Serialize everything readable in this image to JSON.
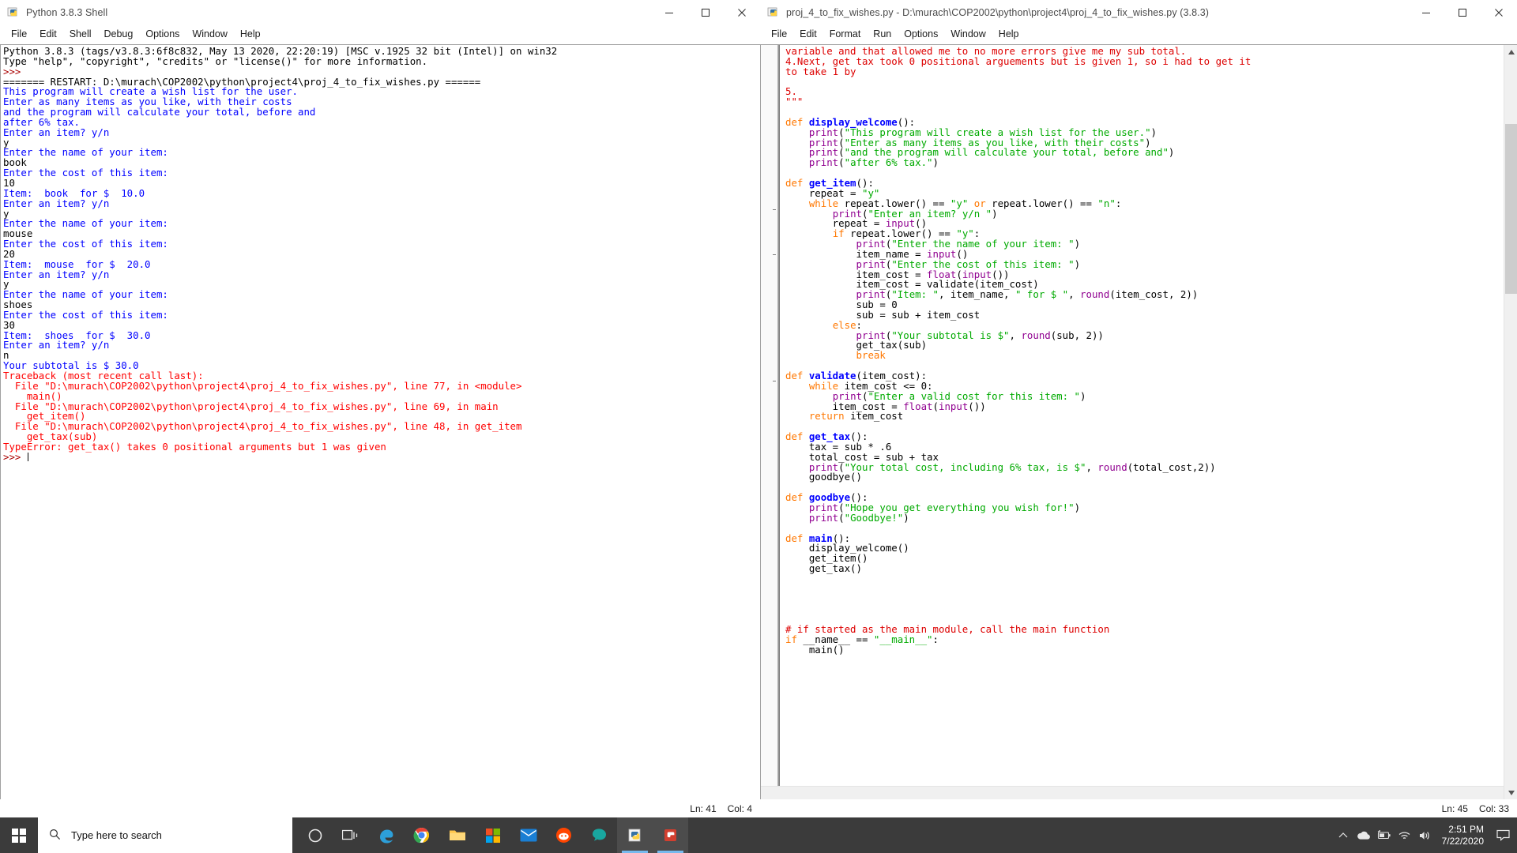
{
  "shell_window": {
    "title": "Python 3.8.3 Shell",
    "icon": "python-idle-icon",
    "menus": [
      "File",
      "Edit",
      "Shell",
      "Debug",
      "Options",
      "Window",
      "Help"
    ],
    "window_controls": {
      "minimize": "minimize-icon",
      "maximize": "maximize-icon",
      "close": "close-icon"
    },
    "status": {
      "line": "Ln: 41",
      "col": "Col: 4"
    },
    "output_lines": [
      {
        "type": "banner",
        "text": "Python 3.8.3 (tags/v3.8.3:6f8c832, May 13 2020, 22:20:19) [MSC v.1925 32 bit (Intel)] on win32"
      },
      {
        "type": "banner",
        "text": "Type \"help\", \"copyright\", \"credits\" or \"license()\" for more information."
      },
      {
        "type": "prompt",
        "text": ">>>"
      },
      {
        "type": "restart",
        "text": "======= RESTART: D:\\murach\\COP2002\\python\\project4\\proj_4_to_fix_wishes.py ======"
      },
      {
        "type": "output",
        "text": "This program will create a wish list for the user."
      },
      {
        "type": "output",
        "text": "Enter as many items as you like, with their costs"
      },
      {
        "type": "output",
        "text": "and the program will calculate your total, before and"
      },
      {
        "type": "output",
        "text": "after 6% tax."
      },
      {
        "type": "output",
        "text": "Enter an item? y/n"
      },
      {
        "type": "input",
        "text": "y"
      },
      {
        "type": "output",
        "text": "Enter the name of your item:"
      },
      {
        "type": "input",
        "text": "book"
      },
      {
        "type": "output",
        "text": "Enter the cost of this item:"
      },
      {
        "type": "input",
        "text": "10"
      },
      {
        "type": "output",
        "text": "Item:  book  for $  10.0"
      },
      {
        "type": "output",
        "text": "Enter an item? y/n"
      },
      {
        "type": "input",
        "text": "y"
      },
      {
        "type": "output",
        "text": "Enter the name of your item:"
      },
      {
        "type": "input",
        "text": "mouse"
      },
      {
        "type": "output",
        "text": "Enter the cost of this item:"
      },
      {
        "type": "input",
        "text": "20"
      },
      {
        "type": "output",
        "text": "Item:  mouse  for $  20.0"
      },
      {
        "type": "output",
        "text": "Enter an item? y/n"
      },
      {
        "type": "input",
        "text": "y"
      },
      {
        "type": "output",
        "text": "Enter the name of your item:"
      },
      {
        "type": "input",
        "text": "shoes"
      },
      {
        "type": "output",
        "text": "Enter the cost of this item:"
      },
      {
        "type": "input",
        "text": "30"
      },
      {
        "type": "output",
        "text": "Item:  shoes  for $  30.0"
      },
      {
        "type": "output",
        "text": "Enter an item? y/n"
      },
      {
        "type": "input",
        "text": "n"
      },
      {
        "type": "output",
        "text": "Your subtotal is $ 30.0"
      },
      {
        "type": "error",
        "text": "Traceback (most recent call last):"
      },
      {
        "type": "error",
        "text": "  File \"D:\\murach\\COP2002\\python\\project4\\proj_4_to_fix_wishes.py\", line 77, in <module>"
      },
      {
        "type": "error",
        "text": "    main()"
      },
      {
        "type": "error",
        "text": "  File \"D:\\murach\\COP2002\\python\\project4\\proj_4_to_fix_wishes.py\", line 69, in main"
      },
      {
        "type": "error",
        "text": "    get_item()"
      },
      {
        "type": "error",
        "text": "  File \"D:\\murach\\COP2002\\python\\project4\\proj_4_to_fix_wishes.py\", line 48, in get_item"
      },
      {
        "type": "error",
        "text": "    get_tax(sub)"
      },
      {
        "type": "error",
        "text": "TypeError: get_tax() takes 0 positional arguments but 1 was given"
      },
      {
        "type": "prompt_cursor",
        "text": ">>> "
      }
    ]
  },
  "editor_window": {
    "title": "proj_4_to_fix_wishes.py - D:\\murach\\COP2002\\python\\project4\\proj_4_to_fix_wishes.py (3.8.3)",
    "icon": "python-idle-icon",
    "menus": [
      "File",
      "Edit",
      "Format",
      "Run",
      "Options",
      "Window",
      "Help"
    ],
    "window_controls": {
      "minimize": "minimize-icon",
      "maximize": "maximize-icon",
      "close": "close-icon"
    },
    "status": {
      "line": "Ln: 45",
      "col": "Col: 33"
    },
    "code_lines": [
      [
        {
          "c": "com",
          "t": "variable and that allowed me to no more errors give me my sub total."
        }
      ],
      [
        {
          "c": "com",
          "t": "4.Next, get tax took 0 positional arguements but is given 1, so i had to get it"
        }
      ],
      [
        {
          "c": "com",
          "t": "to take 1 by"
        }
      ],
      [],
      [
        {
          "c": "com",
          "t": "5."
        }
      ],
      [
        {
          "c": "com",
          "t": "\"\"\""
        }
      ],
      [],
      [
        {
          "c": "kw",
          "t": "def "
        },
        {
          "c": "def",
          "t": "display_welcome"
        },
        {
          "c": "plain",
          "t": "():"
        }
      ],
      [
        {
          "c": "plain",
          "t": "    "
        },
        {
          "c": "bi",
          "t": "print"
        },
        {
          "c": "plain",
          "t": "("
        },
        {
          "c": "str",
          "t": "\"This program will create a wish list for the user.\""
        },
        {
          "c": "plain",
          "t": ")"
        }
      ],
      [
        {
          "c": "plain",
          "t": "    "
        },
        {
          "c": "bi",
          "t": "print"
        },
        {
          "c": "plain",
          "t": "("
        },
        {
          "c": "str",
          "t": "\"Enter as many items as you like, with their costs\""
        },
        {
          "c": "plain",
          "t": ")"
        }
      ],
      [
        {
          "c": "plain",
          "t": "    "
        },
        {
          "c": "bi",
          "t": "print"
        },
        {
          "c": "plain",
          "t": "("
        },
        {
          "c": "str",
          "t": "\"and the program will calculate your total, before and\""
        },
        {
          "c": "plain",
          "t": ")"
        }
      ],
      [
        {
          "c": "plain",
          "t": "    "
        },
        {
          "c": "bi",
          "t": "print"
        },
        {
          "c": "plain",
          "t": "("
        },
        {
          "c": "str",
          "t": "\"after 6% tax.\""
        },
        {
          "c": "plain",
          "t": ")"
        }
      ],
      [],
      [
        {
          "c": "kw",
          "t": "def "
        },
        {
          "c": "def",
          "t": "get_item"
        },
        {
          "c": "plain",
          "t": "():"
        }
      ],
      [
        {
          "c": "plain",
          "t": "    repeat = "
        },
        {
          "c": "str",
          "t": "\"y\""
        }
      ],
      [
        {
          "c": "plain",
          "t": "    "
        },
        {
          "c": "kw",
          "t": "while"
        },
        {
          "c": "plain",
          "t": " repeat.lower() == "
        },
        {
          "c": "str",
          "t": "\"y\""
        },
        {
          "c": "kw",
          "t": " or "
        },
        {
          "c": "plain",
          "t": "repeat.lower() == "
        },
        {
          "c": "str",
          "t": "\"n\""
        },
        {
          "c": "plain",
          "t": ":"
        }
      ],
      [
        {
          "c": "plain",
          "t": "        "
        },
        {
          "c": "bi",
          "t": "print"
        },
        {
          "c": "plain",
          "t": "("
        },
        {
          "c": "str",
          "t": "\"Enter an item? y/n \""
        },
        {
          "c": "plain",
          "t": ")"
        }
      ],
      [
        {
          "c": "plain",
          "t": "        repeat = "
        },
        {
          "c": "bi",
          "t": "input"
        },
        {
          "c": "plain",
          "t": "()"
        }
      ],
      [
        {
          "c": "plain",
          "t": "        "
        },
        {
          "c": "kw",
          "t": "if"
        },
        {
          "c": "plain",
          "t": " repeat.lower() == "
        },
        {
          "c": "str",
          "t": "\"y\""
        },
        {
          "c": "plain",
          "t": ":"
        }
      ],
      [
        {
          "c": "plain",
          "t": "            "
        },
        {
          "c": "bi",
          "t": "print"
        },
        {
          "c": "plain",
          "t": "("
        },
        {
          "c": "str",
          "t": "\"Enter the name of your item: \""
        },
        {
          "c": "plain",
          "t": ")"
        }
      ],
      [
        {
          "c": "plain",
          "t": "            item_name = "
        },
        {
          "c": "bi",
          "t": "input"
        },
        {
          "c": "plain",
          "t": "()"
        }
      ],
      [
        {
          "c": "plain",
          "t": "            "
        },
        {
          "c": "bi",
          "t": "print"
        },
        {
          "c": "plain",
          "t": "("
        },
        {
          "c": "str",
          "t": "\"Enter the cost of this item: \""
        },
        {
          "c": "plain",
          "t": ")"
        }
      ],
      [
        {
          "c": "plain",
          "t": "            item_cost = "
        },
        {
          "c": "bi",
          "t": "float"
        },
        {
          "c": "plain",
          "t": "("
        },
        {
          "c": "bi",
          "t": "input"
        },
        {
          "c": "plain",
          "t": "())"
        }
      ],
      [
        {
          "c": "plain",
          "t": "            item_cost = validate(item_cost)"
        }
      ],
      [
        {
          "c": "plain",
          "t": "            "
        },
        {
          "c": "bi",
          "t": "print"
        },
        {
          "c": "plain",
          "t": "("
        },
        {
          "c": "str",
          "t": "\"Item: \""
        },
        {
          "c": "plain",
          "t": ", item_name, "
        },
        {
          "c": "str",
          "t": "\" for $ \""
        },
        {
          "c": "plain",
          "t": ", "
        },
        {
          "c": "bi",
          "t": "round"
        },
        {
          "c": "plain",
          "t": "(item_cost, 2))"
        }
      ],
      [
        {
          "c": "plain",
          "t": "            sub = 0"
        }
      ],
      [
        {
          "c": "plain",
          "t": "            sub = sub + item_cost"
        }
      ],
      [
        {
          "c": "plain",
          "t": "        "
        },
        {
          "c": "kw",
          "t": "else"
        },
        {
          "c": "plain",
          "t": ":"
        }
      ],
      [
        {
          "c": "plain",
          "t": "            "
        },
        {
          "c": "bi",
          "t": "print"
        },
        {
          "c": "plain",
          "t": "("
        },
        {
          "c": "str",
          "t": "\"Your subtotal is $\""
        },
        {
          "c": "plain",
          "t": ", "
        },
        {
          "c": "bi",
          "t": "round"
        },
        {
          "c": "plain",
          "t": "(sub, 2))"
        }
      ],
      [
        {
          "c": "plain",
          "t": "            get_tax(sub)"
        }
      ],
      [
        {
          "c": "plain",
          "t": "            "
        },
        {
          "c": "kw",
          "t": "break"
        }
      ],
      [],
      [
        {
          "c": "kw",
          "t": "def "
        },
        {
          "c": "def",
          "t": "validate"
        },
        {
          "c": "plain",
          "t": "(item_cost):"
        }
      ],
      [
        {
          "c": "plain",
          "t": "    "
        },
        {
          "c": "kw",
          "t": "while"
        },
        {
          "c": "plain",
          "t": " item_cost <= 0:"
        }
      ],
      [
        {
          "c": "plain",
          "t": "        "
        },
        {
          "c": "bi",
          "t": "print"
        },
        {
          "c": "plain",
          "t": "("
        },
        {
          "c": "str",
          "t": "\"Enter a valid cost for this item: \""
        },
        {
          "c": "plain",
          "t": ")"
        }
      ],
      [
        {
          "c": "plain",
          "t": "        item_cost = "
        },
        {
          "c": "bi",
          "t": "float"
        },
        {
          "c": "plain",
          "t": "("
        },
        {
          "c": "bi",
          "t": "input"
        },
        {
          "c": "plain",
          "t": "())"
        }
      ],
      [
        {
          "c": "plain",
          "t": "    "
        },
        {
          "c": "kw",
          "t": "return"
        },
        {
          "c": "plain",
          "t": " item_cost"
        }
      ],
      [],
      [
        {
          "c": "kw",
          "t": "def "
        },
        {
          "c": "def",
          "t": "get_tax"
        },
        {
          "c": "plain",
          "t": "():"
        }
      ],
      [
        {
          "c": "plain",
          "t": "    tax = sub * .6"
        }
      ],
      [
        {
          "c": "plain",
          "t": "    total_cost = sub + tax"
        }
      ],
      [
        {
          "c": "plain",
          "t": "    "
        },
        {
          "c": "bi",
          "t": "print"
        },
        {
          "c": "plain",
          "t": "("
        },
        {
          "c": "str",
          "t": "\"Your total cost, including 6% tax, is $\""
        },
        {
          "c": "plain",
          "t": ", "
        },
        {
          "c": "bi",
          "t": "round"
        },
        {
          "c": "plain",
          "t": "(total_cost,2))"
        }
      ],
      [
        {
          "c": "plain",
          "t": "    goodbye()"
        }
      ],
      [],
      [
        {
          "c": "kw",
          "t": "def "
        },
        {
          "c": "def",
          "t": "goodbye"
        },
        {
          "c": "plain",
          "t": "():"
        }
      ],
      [
        {
          "c": "plain",
          "t": "    "
        },
        {
          "c": "bi",
          "t": "print"
        },
        {
          "c": "plain",
          "t": "("
        },
        {
          "c": "str",
          "t": "\"Hope you get everything you wish for!\""
        },
        {
          "c": "plain",
          "t": ")"
        }
      ],
      [
        {
          "c": "plain",
          "t": "    "
        },
        {
          "c": "bi",
          "t": "print"
        },
        {
          "c": "plain",
          "t": "("
        },
        {
          "c": "str",
          "t": "\"Goodbye!\""
        },
        {
          "c": "plain",
          "t": ")"
        }
      ],
      [],
      [
        {
          "c": "kw",
          "t": "def "
        },
        {
          "c": "def",
          "t": "main"
        },
        {
          "c": "plain",
          "t": "():"
        }
      ],
      [
        {
          "c": "plain",
          "t": "    display_welcome()"
        }
      ],
      [
        {
          "c": "plain",
          "t": "    get_item()"
        }
      ],
      [
        {
          "c": "plain",
          "t": "    get_tax()"
        }
      ],
      [],
      [],
      [],
      [],
      [],
      [
        {
          "c": "com",
          "t": "# if started as the main module, call the main function"
        }
      ],
      [
        {
          "c": "kw",
          "t": "if"
        },
        {
          "c": "plain",
          "t": " __name__ == "
        },
        {
          "c": "str",
          "t": "\"__main__\""
        },
        {
          "c": "plain",
          "t": ":"
        }
      ],
      [
        {
          "c": "plain",
          "t": "    main()"
        }
      ]
    ]
  },
  "taskbar": {
    "start": "windows-start-icon",
    "search_placeholder": "Type here to search",
    "search_icon": "search-icon",
    "apps": [
      {
        "name": "cortana-icon"
      },
      {
        "name": "task-view-icon"
      },
      {
        "name": "edge-icon"
      },
      {
        "name": "chrome-icon"
      },
      {
        "name": "file-explorer-icon"
      },
      {
        "name": "microsoft-store-icon"
      },
      {
        "name": "mail-icon"
      },
      {
        "name": "reddit-icon"
      },
      {
        "name": "teal-app-icon"
      },
      {
        "name": "idle-editor-icon"
      },
      {
        "name": "idle-shell-icon"
      }
    ],
    "tray": {
      "show_hidden": "chevron-up-icon",
      "onedrive": "onedrive-icon",
      "battery": "battery-icon",
      "network": "wifi-icon",
      "volume": "speaker-icon",
      "time": "2:51 PM",
      "date": "7/22/2020",
      "action_center": "notification-icon"
    }
  },
  "colors": {
    "keyword": "#ff7700",
    "definition": "#0000ff",
    "string": "#00aa00",
    "builtin": "#900090",
    "comment": "#dd0000",
    "shell_output": "#0000ff",
    "shell_error": "#ff0000",
    "taskbar_bg": "#3b3b3b",
    "accent": "#76b9ed"
  }
}
